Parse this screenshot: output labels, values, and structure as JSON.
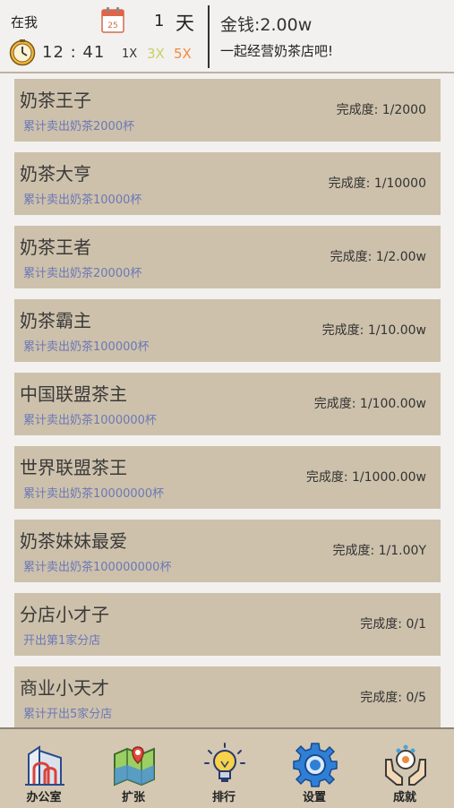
{
  "header": {
    "player_name": "在我",
    "calendar_day_icon": "25",
    "day_number": "1",
    "day_unit": "天",
    "time": "12 : 41",
    "speed_options": [
      "1X",
      "3X",
      "5X"
    ],
    "money": "金钱:2.00w",
    "slogan": "一起经营奶茶店吧!"
  },
  "achievements": [
    {
      "title": "奶茶王子",
      "desc": "累计卖出奶茶2000杯",
      "progress": "完成度: 1/2000"
    },
    {
      "title": "奶茶大亨",
      "desc": "累计卖出奶茶10000杯",
      "progress": "完成度: 1/10000"
    },
    {
      "title": "奶茶王者",
      "desc": "累计卖出奶茶20000杯",
      "progress": "完成度: 1/2.00w"
    },
    {
      "title": "奶茶霸主",
      "desc": "累计卖出奶茶100000杯",
      "progress": "完成度: 1/10.00w"
    },
    {
      "title": "中国联盟茶主",
      "desc": "累计卖出奶茶1000000杯",
      "progress": "完成度: 1/100.00w"
    },
    {
      "title": "世界联盟茶王",
      "desc": "累计卖出奶茶10000000杯",
      "progress": "完成度: 1/1000.00w"
    },
    {
      "title": "奶茶妹妹最爱",
      "desc": "累计卖出奶茶100000000杯",
      "progress": "完成度: 1/1.00Y"
    },
    {
      "title": "分店小才子",
      "desc": "开出第1家分店",
      "progress": "完成度: 0/1"
    },
    {
      "title": "商业小天才",
      "desc": "累计开出5家分店",
      "progress": "完成度: 0/5"
    }
  ],
  "nav": [
    {
      "label": "办公室",
      "icon": "office-building-icon"
    },
    {
      "label": "扩张",
      "icon": "map-icon"
    },
    {
      "label": "排行",
      "icon": "lightbulb-icon"
    },
    {
      "label": "设置",
      "icon": "gear-icon"
    },
    {
      "label": "成就",
      "icon": "achievement-hands-icon"
    }
  ],
  "colors": {
    "card_bg": "#cdc1ab",
    "desc_text": "#6b78b8",
    "speed_3x": "#c8cf63",
    "speed_5x": "#f08a3c",
    "nav_bg": "#d4c8b3"
  }
}
